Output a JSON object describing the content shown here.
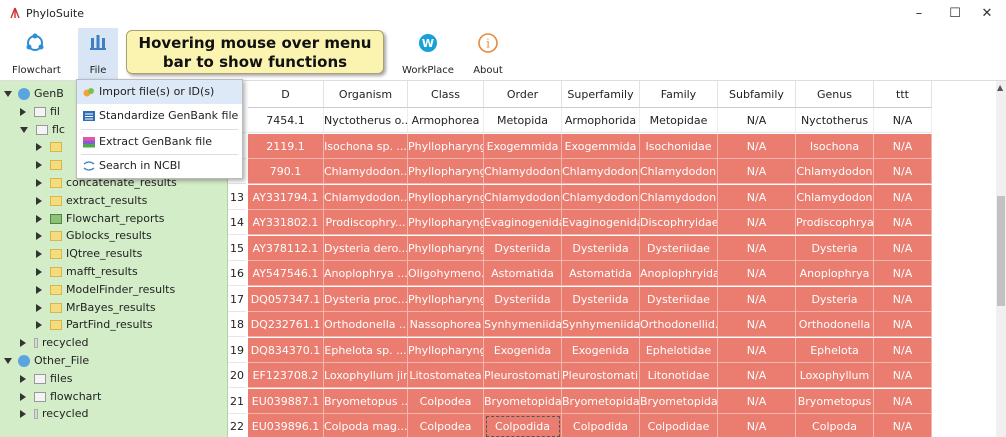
{
  "window": {
    "title": "PhyloSuite",
    "controls": [
      "–",
      "☐",
      "✕"
    ]
  },
  "toolbar": {
    "items": [
      {
        "label": "Flowchart",
        "icon": "flowchart-icon"
      },
      {
        "label": "File",
        "icon": "file-icon"
      },
      {
        "label": "WorkPlace",
        "icon": "workplace-icon"
      },
      {
        "label": "About",
        "icon": "about-icon"
      }
    ]
  },
  "callout": {
    "line1": "Hovering mouse over menu",
    "line2": "bar to show functions"
  },
  "file_menu": {
    "items": [
      {
        "label": "Import file(s) or ID(s)",
        "icon": "import-icon"
      },
      {
        "label": "Standardize GenBank file",
        "icon": "standardize-icon"
      },
      {
        "label": "Extract GenBank file",
        "icon": "extract-icon"
      },
      {
        "label": "Search in NCBI",
        "icon": "search-ncbi-icon"
      }
    ]
  },
  "tree": {
    "rows": [
      {
        "text": "GenB",
        "level": 0,
        "arrow": "down",
        "kind": "gear"
      },
      {
        "text": "fil",
        "level": 1,
        "arrow": "right",
        "kind": "white"
      },
      {
        "text": "flc",
        "level": 1,
        "arrow": "down",
        "kind": "white"
      },
      {
        "text": "",
        "level": 2,
        "arrow": "right",
        "kind": "folder"
      },
      {
        "text": "",
        "level": 2,
        "arrow": "right",
        "kind": "folder"
      },
      {
        "text": "concatenate_results",
        "level": 2,
        "arrow": "right",
        "kind": "folder"
      },
      {
        "text": "extract_results",
        "level": 2,
        "arrow": "right",
        "kind": "folder"
      },
      {
        "text": "Flowchart_reports",
        "level": 2,
        "arrow": "right",
        "kind": "check"
      },
      {
        "text": "Gblocks_results",
        "level": 2,
        "arrow": "right",
        "kind": "folder"
      },
      {
        "text": "IQtree_results",
        "level": 2,
        "arrow": "right",
        "kind": "folder"
      },
      {
        "text": "mafft_results",
        "level": 2,
        "arrow": "right",
        "kind": "folder"
      },
      {
        "text": "ModelFinder_results",
        "level": 2,
        "arrow": "right",
        "kind": "folder"
      },
      {
        "text": "MrBayes_results",
        "level": 2,
        "arrow": "right",
        "kind": "folder"
      },
      {
        "text": "PartFind_results",
        "level": 2,
        "arrow": "right",
        "kind": "folder"
      },
      {
        "text": "recycled",
        "level": 1,
        "arrow": "right",
        "kind": "gray"
      },
      {
        "text": "Other_File",
        "level": 0,
        "arrow": "down",
        "kind": "gear"
      },
      {
        "text": "files",
        "level": 1,
        "arrow": "right",
        "kind": "white"
      },
      {
        "text": "flowchart",
        "level": 1,
        "arrow": "right",
        "kind": "white"
      },
      {
        "text": "recycled",
        "level": 1,
        "arrow": "right",
        "kind": "gray"
      }
    ]
  },
  "table": {
    "columns": [
      "D",
      "Organism",
      "Class",
      "Order",
      "Superfamily",
      "Family",
      "Subfamily",
      "Genus",
      "ttt"
    ],
    "rows": [
      {
        "num": "",
        "white": true,
        "cells": [
          "7454.1",
          "Nyctotherus o...",
          "Armophorea",
          "Metopida",
          "Armophorida",
          "Metopidae",
          "N/A",
          "Nyctotherus",
          "N/A"
        ]
      },
      {
        "num": "",
        "white": false,
        "cells": [
          "2119.1",
          "Isochona sp. ...",
          "Phyllopharyng...",
          "Exogemmida",
          "Exogemmida",
          "Isochonidae",
          "N/A",
          "Isochona",
          "N/A"
        ]
      },
      {
        "num": "",
        "white": false,
        "cells": [
          "790.1",
          "Chlamydodon...",
          "Phyllopharyng...",
          "Chlamydodon...",
          "Chlamydodon...",
          "Chlamydodon...",
          "N/A",
          "Chlamydodon",
          "N/A"
        ]
      },
      {
        "num": "13",
        "white": false,
        "cells": [
          "AY331794.1",
          "Chlamydodon...",
          "Phyllopharyng...",
          "Chlamydodon...",
          "Chlamydodon...",
          "Chlamydodon...",
          "N/A",
          "Chlamydodon",
          "N/A"
        ]
      },
      {
        "num": "14",
        "white": false,
        "cells": [
          "AY331802.1",
          "Prodiscophry...",
          "Phyllopharyng...",
          "Evaginogenida",
          "Evaginogenida",
          "Discophryidae",
          "N/A",
          "Prodiscophrya",
          "N/A"
        ]
      },
      {
        "num": "15",
        "white": false,
        "cells": [
          "AY378112.1",
          "Dysteria dero...",
          "Phyllopharyng...",
          "Dysteriida",
          "Dysteriida",
          "Dysteriidae",
          "N/A",
          "Dysteria",
          "N/A"
        ]
      },
      {
        "num": "16",
        "white": false,
        "cells": [
          "AY547546.1",
          "Anoplophrya ...",
          "Oligohymeno...",
          "Astomatida",
          "Astomatida",
          "Anoplophryidae",
          "N/A",
          "Anoplophrya",
          "N/A"
        ]
      },
      {
        "num": "17",
        "white": false,
        "cells": [
          "DQ057347.1",
          "Dysteria proc...",
          "Phyllopharyng...",
          "Dysteriida",
          "Dysteriida",
          "Dysteriidae",
          "N/A",
          "Dysteria",
          "N/A"
        ]
      },
      {
        "num": "18",
        "white": false,
        "cells": [
          "DQ232761.1",
          "Orthodonella ...",
          "Nassophorea",
          "Synhymeniida",
          "Synhymeniida",
          "Orthodonellid...",
          "N/A",
          "Orthodonella",
          "N/A"
        ]
      },
      {
        "num": "19",
        "white": false,
        "cells": [
          "DQ834370.1",
          "Ephelota sp. ...",
          "Phyllopharyng...",
          "Exogenida",
          "Exogenida",
          "Ephelotidae",
          "N/A",
          "Ephelota",
          "N/A"
        ]
      },
      {
        "num": "20",
        "white": false,
        "cells": [
          "EF123708.2",
          "Loxophyllum jini",
          "Litostomatea",
          "Pleurostomati...",
          "Pleurostomati...",
          "Litonotidae",
          "N/A",
          "Loxophyllum",
          "N/A"
        ]
      },
      {
        "num": "21",
        "white": false,
        "cells": [
          "EU039887.1",
          "Bryometopus ...",
          "Colpodea",
          "Bryometopida",
          "Bryometopida",
          "Bryometopidae",
          "N/A",
          "Bryometopus",
          "N/A"
        ]
      },
      {
        "num": "22",
        "white": false,
        "cells": [
          "EU039896.1",
          "Colpoda mag...",
          "Colpodea",
          "Colpodida",
          "Colpodida",
          "Colpodidae",
          "N/A",
          "Colpoda",
          "N/A"
        ]
      }
    ],
    "selected": {
      "row": 12,
      "col": 3
    }
  },
  "colors": {
    "highlight_row": "#ea7d6f",
    "tree_background": "#d4edc9",
    "callout_background": "#fbf3b0"
  }
}
